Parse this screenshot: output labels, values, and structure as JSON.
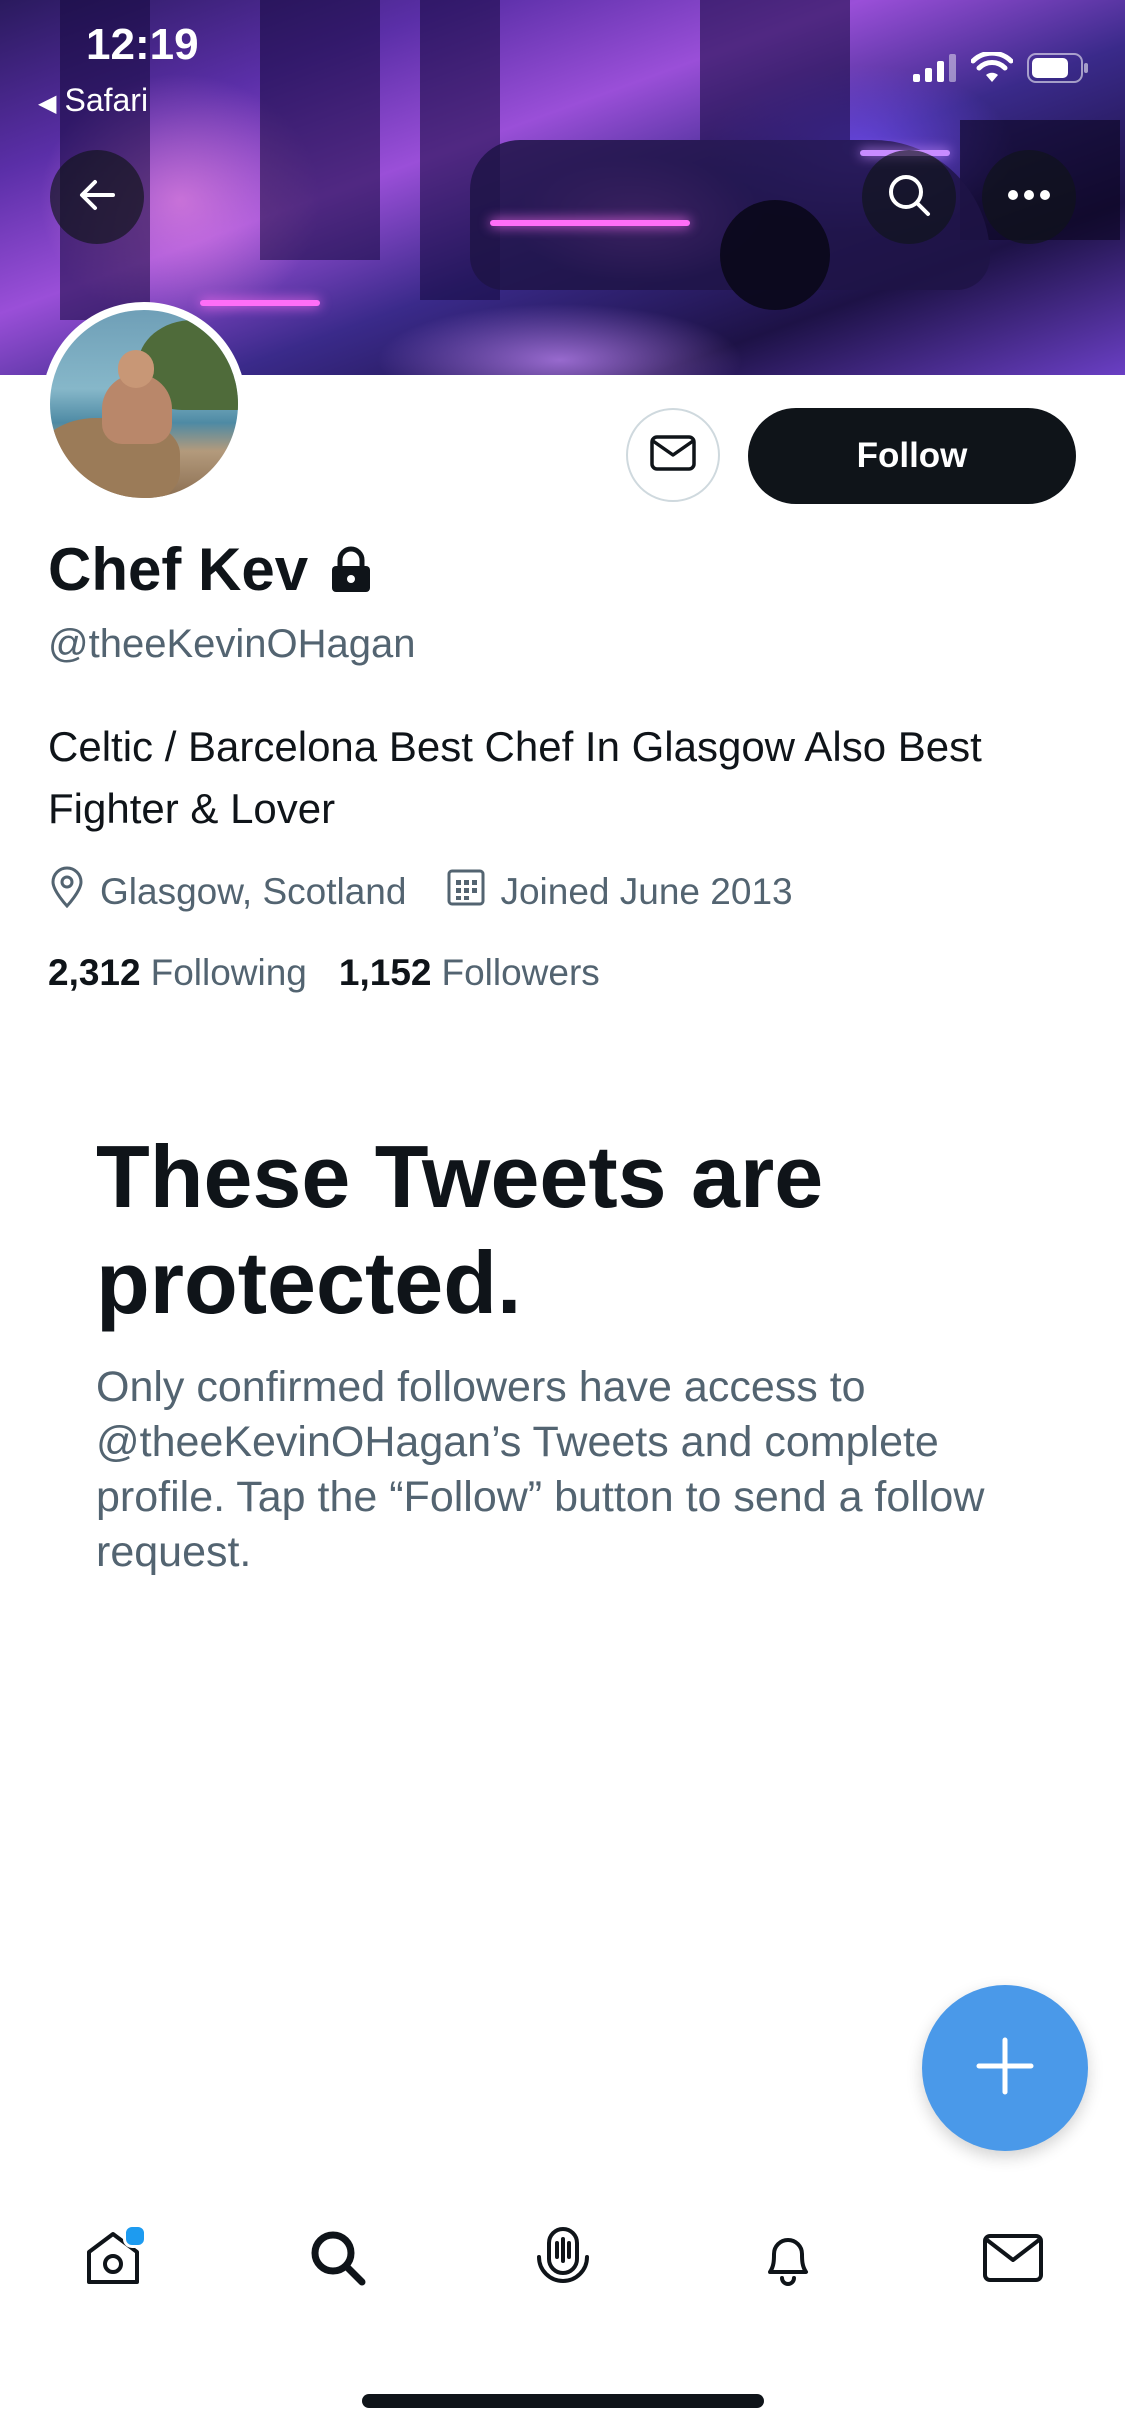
{
  "status_bar": {
    "time": "12:19",
    "back_app": "Safari"
  },
  "profile": {
    "name": "Chef Kev",
    "handle": "@theeKevinOHagan",
    "bio": "Celtic / Barcelona Best Chef In Glasgow Also Best Fighter & Lover",
    "location": "Glasgow, Scotland",
    "joined": "Joined June 2013",
    "following_count": "2,312",
    "following_label": "Following",
    "followers_count": "1,152",
    "followers_label": "Followers",
    "protected_icon": "lock-icon"
  },
  "actions": {
    "follow_label": "Follow",
    "message_icon": "envelope-icon"
  },
  "protected_notice": {
    "title": "These Tweets are protected.",
    "description": "Only confirmed followers have access to @theeKevinOHagan’s Tweets and complete profile. Tap the “Follow” button to send a follow request."
  },
  "tab_bar": {
    "items": [
      {
        "icon": "home-icon",
        "has_notification_dot": true
      },
      {
        "icon": "search-icon",
        "active": true
      },
      {
        "icon": "spaces-icon"
      },
      {
        "icon": "bell-icon"
      },
      {
        "icon": "envelope-icon"
      }
    ]
  },
  "colors": {
    "accent": "#1d9bf0",
    "fab": "#4a99e9",
    "text_primary": "#0f1419",
    "text_secondary": "#536471"
  }
}
